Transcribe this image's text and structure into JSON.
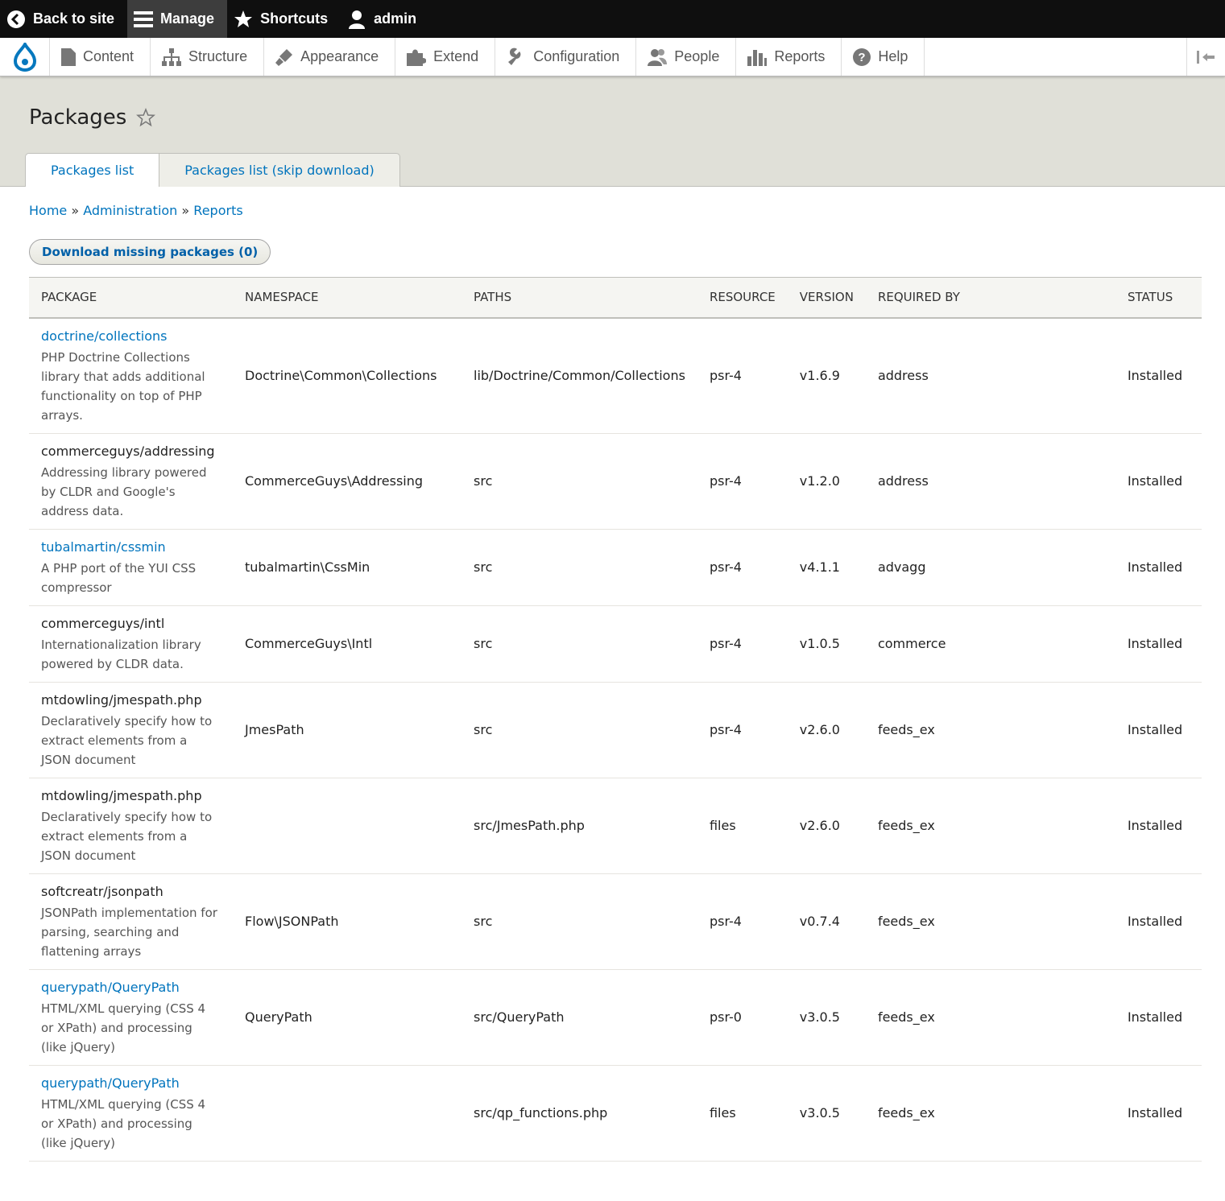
{
  "toolbar": {
    "back_label": "Back to site",
    "manage_label": "Manage",
    "shortcuts_label": "Shortcuts",
    "user_label": "admin"
  },
  "menu": {
    "items": [
      {
        "label": "Content",
        "icon": "file-icon"
      },
      {
        "label": "Structure",
        "icon": "sitemap-icon"
      },
      {
        "label": "Appearance",
        "icon": "paintbrush-icon"
      },
      {
        "label": "Extend",
        "icon": "puzzle-icon"
      },
      {
        "label": "Configuration",
        "icon": "wrench-icon"
      },
      {
        "label": "People",
        "icon": "people-icon"
      },
      {
        "label": "Reports",
        "icon": "bar-chart-icon"
      },
      {
        "label": "Help",
        "icon": "help-icon"
      }
    ]
  },
  "page": {
    "title": "Packages",
    "tabs": [
      "Packages list",
      "Packages list (skip download)"
    ]
  },
  "breadcrumb": {
    "home": "Home",
    "administration": "Administration",
    "reports": "Reports",
    "separator": "»"
  },
  "actions": {
    "download_label": "Download missing packages (0)"
  },
  "table": {
    "headers": [
      "Package",
      "Namespace",
      "Paths",
      "Resource",
      "Version",
      "Required by",
      "Status"
    ],
    "rows": [
      {
        "name": "doctrine/collections",
        "link": true,
        "desc": "PHP Doctrine Collections library that adds additional functionality on top of PHP arrays.",
        "namespace": "Doctrine\\Common\\Collections",
        "paths": "lib/Doctrine/Common/Collections",
        "resource": "psr-4",
        "version": "v1.6.9",
        "required_by": "address",
        "status": "Installed"
      },
      {
        "name": "commerceguys/addressing",
        "link": false,
        "desc": "Addressing library powered by CLDR and Google's address data.",
        "namespace": "CommerceGuys\\Addressing",
        "paths": "src",
        "resource": "psr-4",
        "version": "v1.2.0",
        "required_by": "address",
        "status": "Installed"
      },
      {
        "name": "tubalmartin/cssmin",
        "link": true,
        "desc": "A PHP port of the YUI CSS compressor",
        "namespace": "tubalmartin\\CssMin",
        "paths": "src",
        "resource": "psr-4",
        "version": "v4.1.1",
        "required_by": "advagg",
        "status": "Installed"
      },
      {
        "name": "commerceguys/intl",
        "link": false,
        "desc": "Internationalization library powered by CLDR data.",
        "namespace": "CommerceGuys\\Intl",
        "paths": "src",
        "resource": "psr-4",
        "version": "v1.0.5",
        "required_by": "commerce",
        "status": "Installed"
      },
      {
        "name": "mtdowling/jmespath.php",
        "link": false,
        "desc": "Declaratively specify how to extract elements from a JSON document",
        "namespace": "JmesPath",
        "paths": "src",
        "resource": "psr-4",
        "version": "v2.6.0",
        "required_by": "feeds_ex",
        "status": "Installed"
      },
      {
        "name": "mtdowling/jmespath.php",
        "link": false,
        "desc": "Declaratively specify how to extract elements from a JSON document",
        "namespace": "",
        "paths": "src/JmesPath.php",
        "resource": "files",
        "version": "v2.6.0",
        "required_by": "feeds_ex",
        "status": "Installed"
      },
      {
        "name": "softcreatr/jsonpath",
        "link": false,
        "desc": "JSONPath implementation for parsing, searching and flattening arrays",
        "namespace": "Flow\\JSONPath",
        "paths": "src",
        "resource": "psr-4",
        "version": "v0.7.4",
        "required_by": "feeds_ex",
        "status": "Installed"
      },
      {
        "name": "querypath/QueryPath",
        "link": true,
        "desc": "HTML/XML querying (CSS 4 or XPath) and processing (like jQuery)",
        "namespace": "QueryPath",
        "paths": "src/QueryPath",
        "resource": "psr-0",
        "version": "v3.0.5",
        "required_by": "feeds_ex",
        "status": "Installed"
      },
      {
        "name": "querypath/QueryPath",
        "link": true,
        "desc": "HTML/XML querying (CSS 4 or XPath) and processing (like jQuery)",
        "namespace": "",
        "paths": "src/qp_functions.php",
        "resource": "files",
        "version": "v3.0.5",
        "required_by": "feeds_ex",
        "status": "Installed"
      }
    ]
  }
}
